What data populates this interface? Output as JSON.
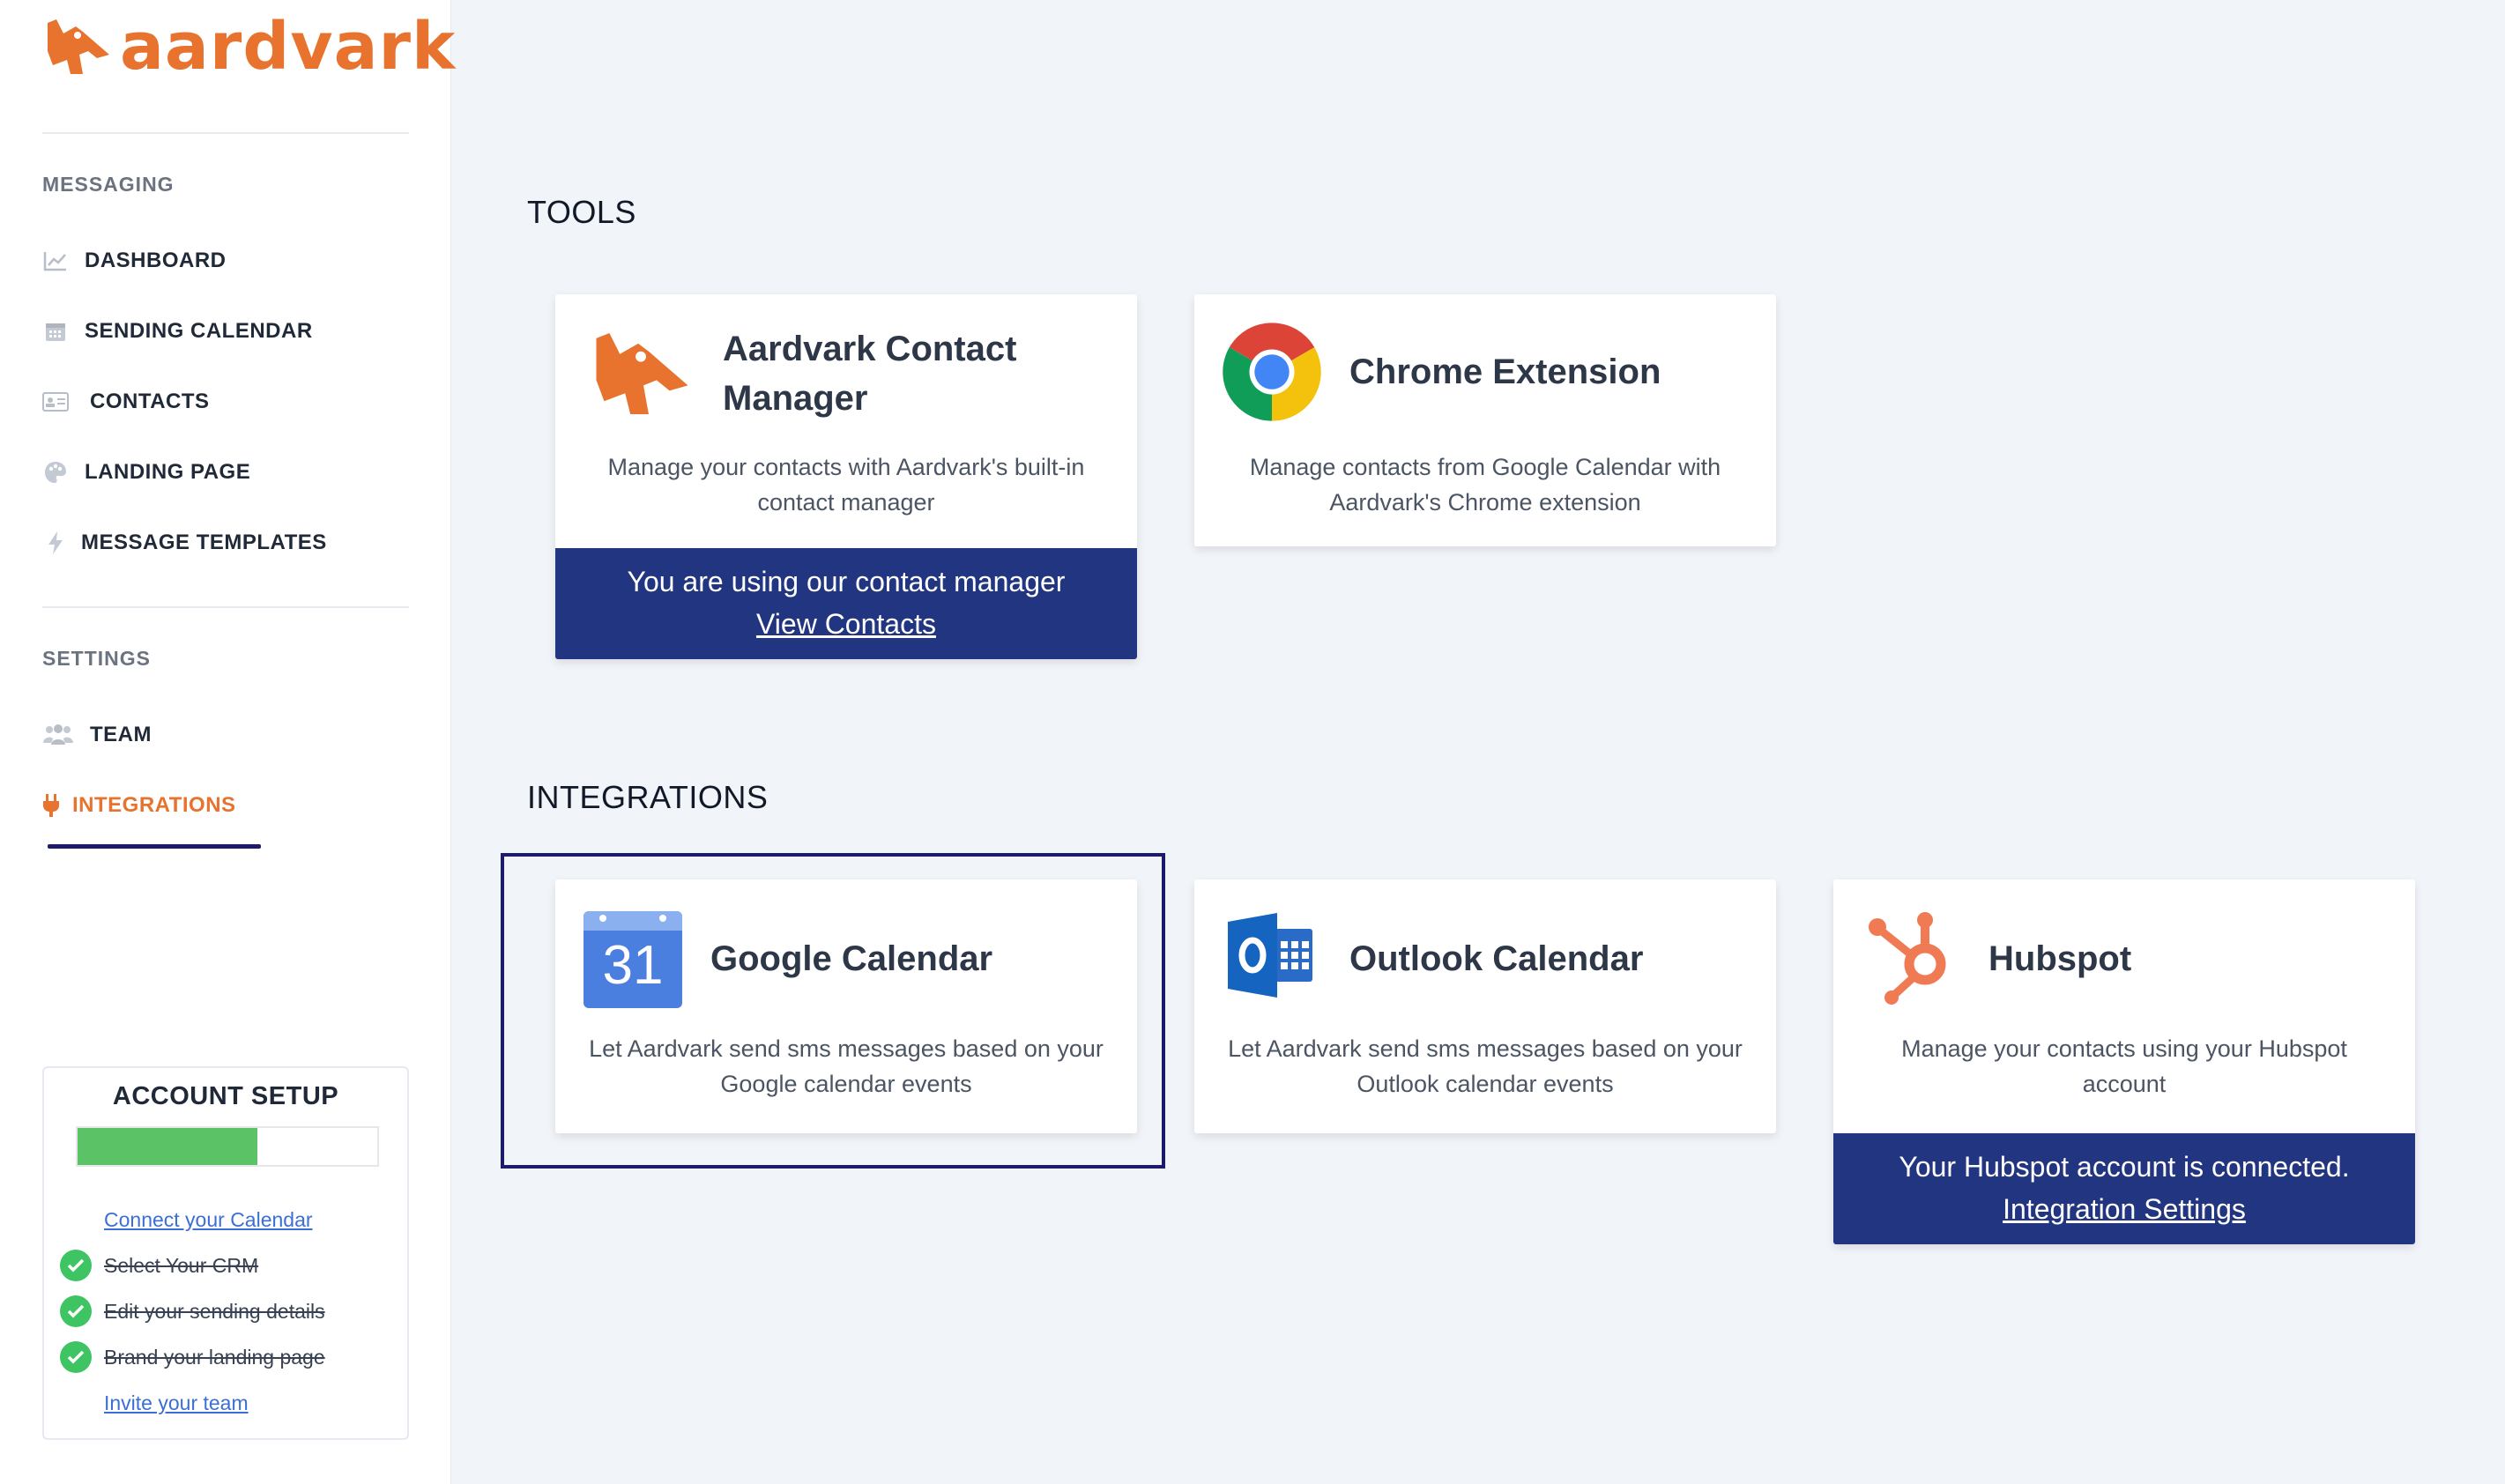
{
  "brand": {
    "name": "aardvark",
    "color": "#e8732e"
  },
  "sidebar": {
    "messaging_label": "MESSAGING",
    "messaging_items": [
      {
        "label": "DASHBOARD",
        "icon": "chart-line-icon"
      },
      {
        "label": "SENDING CALENDAR",
        "icon": "calendar-icon"
      },
      {
        "label": "CONTACTS",
        "icon": "address-card-icon"
      },
      {
        "label": "LANDING PAGE",
        "icon": "palette-icon"
      },
      {
        "label": "MESSAGE TEMPLATES",
        "icon": "bolt-icon"
      }
    ],
    "settings_label": "SETTINGS",
    "settings_items": [
      {
        "label": "TEAM",
        "icon": "users-icon"
      },
      {
        "label": "INTEGRATIONS",
        "icon": "plug-icon",
        "active": true
      }
    ]
  },
  "account_setup": {
    "title": "ACCOUNT SETUP",
    "progress_percent": 60,
    "steps": [
      {
        "label": "Connect your Calendar",
        "done": false
      },
      {
        "label": "Select Your CRM",
        "done": true
      },
      {
        "label": "Edit your sending details",
        "done": true
      },
      {
        "label": "Brand your landing page",
        "done": true
      },
      {
        "label": "Invite your team",
        "done": false
      }
    ]
  },
  "tools": {
    "heading": "TOOLS",
    "cards": [
      {
        "title": "Aardvark Contact Manager",
        "description": "Manage your contacts with Aardvark's built-in contact manager",
        "footer_text": "You are using our contact manager",
        "footer_link": "View Contacts",
        "icon": "aardvark-logo-icon"
      },
      {
        "title": "Chrome Extension",
        "description": "Manage contacts from Google Calendar with Aardvark's Chrome extension",
        "icon": "chrome-icon"
      }
    ]
  },
  "integrations": {
    "heading": "INTEGRATIONS",
    "cards": [
      {
        "title": "Google Calendar",
        "description": "Let Aardvark send sms messages based on your Google calendar events",
        "icon": "google-calendar-icon",
        "icon_text": "31",
        "selected": true
      },
      {
        "title": "Outlook Calendar",
        "description": "Let Aardvark send sms messages based on your Outlook calendar events",
        "icon": "outlook-icon"
      },
      {
        "title": "Hubspot",
        "description": "Manage your contacts using your Hubspot account",
        "footer_text": "Your Hubspot account is connected.",
        "footer_link": "Integration Settings",
        "icon": "hubspot-icon"
      }
    ]
  },
  "colors": {
    "accent": "#e8732e",
    "footer_bg": "#223580",
    "progress": "#5bc266",
    "check": "#3ec462",
    "selected_outline": "#1e1b6b"
  }
}
